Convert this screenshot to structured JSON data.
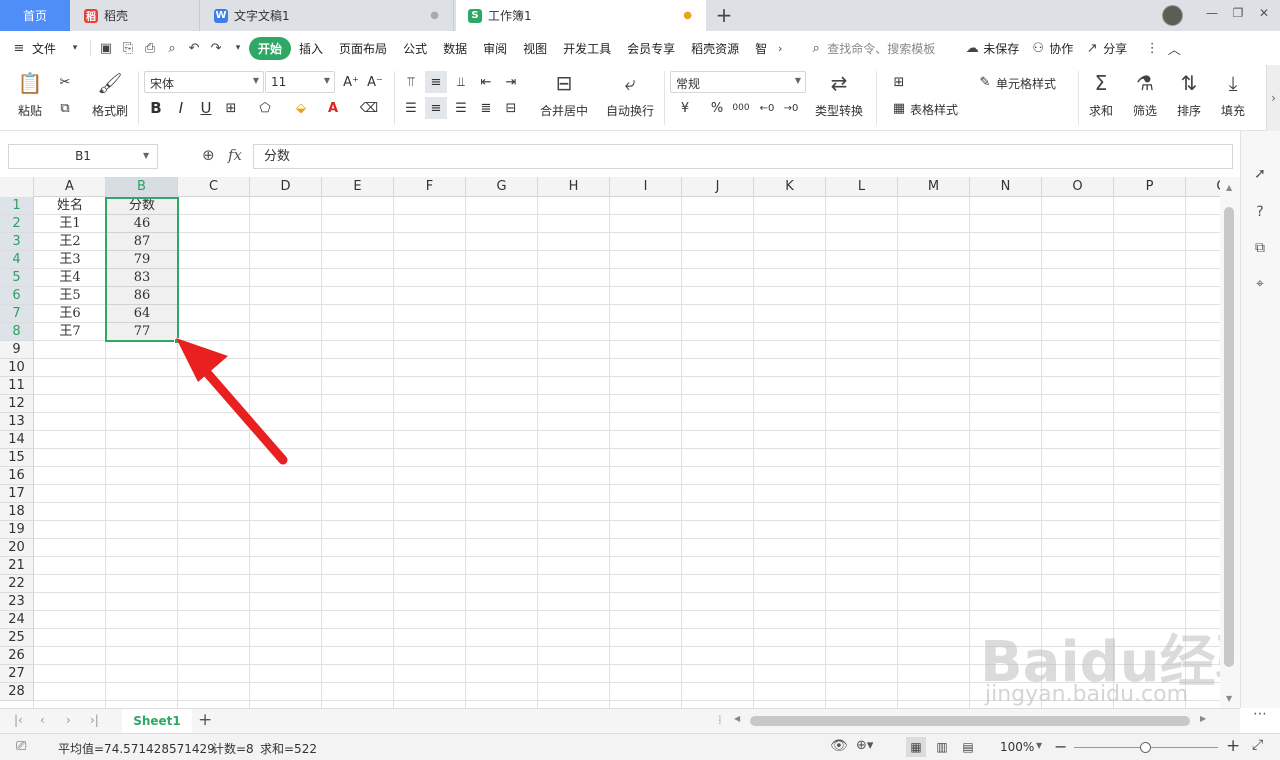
{
  "tabs": {
    "home": "首页",
    "daoke": "稻壳",
    "doc": "文字文稿1",
    "book": "工作簿1",
    "add": "+"
  },
  "window": {
    "minimize": "—",
    "restore": "❐",
    "close": "✕"
  },
  "menu": {
    "file": "文件",
    "items": [
      "开始",
      "插入",
      "页面布局",
      "公式",
      "数据",
      "审阅",
      "视图",
      "开发工具",
      "会员专享",
      "稻壳资源",
      "智"
    ],
    "search_placeholder": "查找命令、搜索模板",
    "unsaved": "未保存",
    "collab": "协作",
    "share": "分享"
  },
  "ribbon": {
    "paste": "粘贴",
    "format_painter": "格式刷",
    "font_name": "宋体",
    "font_size": "11",
    "merge_center": "合并居中",
    "auto_wrap": "自动换行",
    "number_format": "常规",
    "type_convert": "类型转换",
    "cell_style": "单元格样式",
    "table_style": "表格样式",
    "sum": "求和",
    "filter": "筛选",
    "sort": "排序",
    "fill": "填充",
    "currency": "¥",
    "percent": "%",
    "thousands": "000"
  },
  "formula_bar": {
    "name_box": "B1",
    "fx": "fx",
    "content": "分数"
  },
  "grid": {
    "columns": [
      "A",
      "B",
      "C",
      "D",
      "E",
      "F",
      "G",
      "H",
      "I",
      "J",
      "K",
      "L",
      "M",
      "N",
      "O",
      "P",
      "Q"
    ],
    "rows": [
      "1",
      "2",
      "3",
      "4",
      "5",
      "6",
      "7",
      "8",
      "9",
      "10",
      "11",
      "12",
      "13",
      "14",
      "15",
      "16",
      "17",
      "18",
      "19",
      "20",
      "21",
      "22",
      "23",
      "24",
      "25",
      "26",
      "27",
      "28"
    ],
    "header": [
      "姓名",
      "分数"
    ],
    "data": [
      [
        "王1",
        "46"
      ],
      [
        "王2",
        "87"
      ],
      [
        "王3",
        "79"
      ],
      [
        "王4",
        "83"
      ],
      [
        "王5",
        "86"
      ],
      [
        "王6",
        "64"
      ],
      [
        "王7",
        "77"
      ]
    ],
    "selected_column": "B",
    "selected_rows": [
      "1",
      "2",
      "3",
      "4",
      "5",
      "6",
      "7",
      "8"
    ]
  },
  "sheet": {
    "name": "Sheet1",
    "add": "+"
  },
  "status": {
    "average": "平均值=74.571428571429",
    "count": "计数=8",
    "sum": "求和=522",
    "zoom": "100%"
  },
  "watermark": {
    "brand": "Baidu经验",
    "url": "jingyan.baidu.com"
  },
  "colors": {
    "accent": "#2fa865",
    "home_tab": "#4f8ef7",
    "arrow": "#e8201f"
  }
}
